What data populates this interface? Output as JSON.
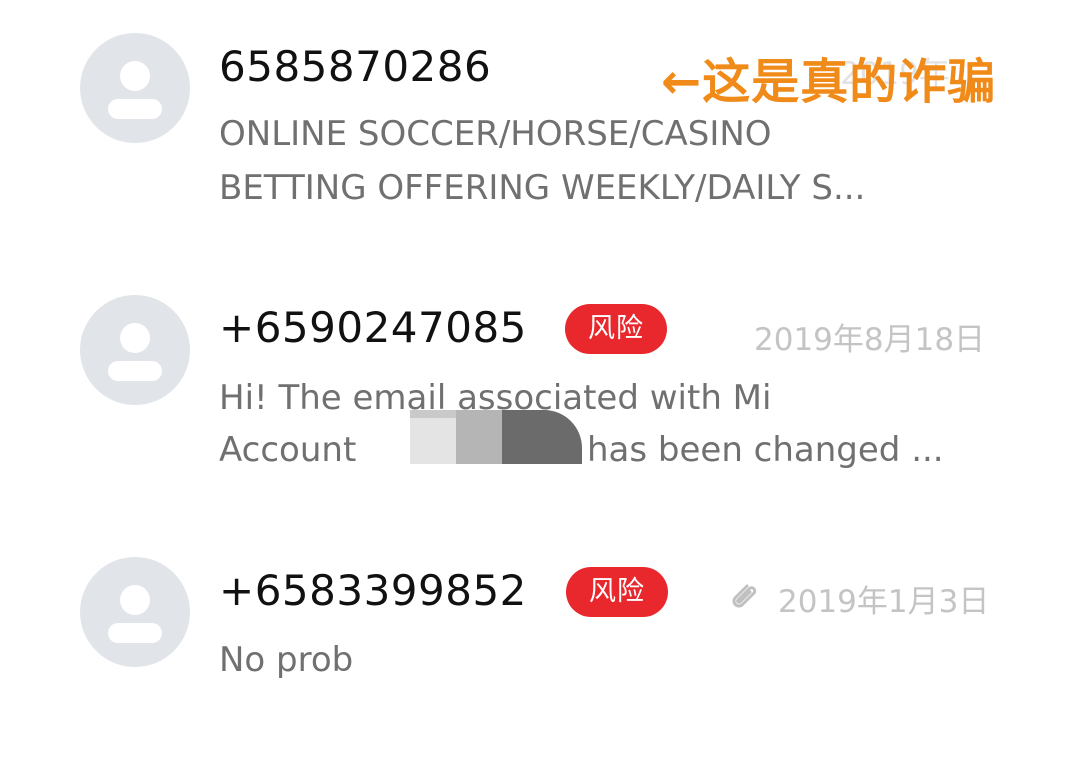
{
  "threads": [
    {
      "sender": "6585870286",
      "badge": "",
      "date": "2019年...",
      "preview_lines": [
        "ONLINE SOCCER/HORSE/CASINO",
        "BETTING OFFERING WEEKLY/DAILY S..."
      ],
      "has_attachment": false
    },
    {
      "sender": "+6590247085",
      "badge": "风险",
      "date": "2019年8月18日",
      "preview_lines": [
        "Hi! The email associated with Mi",
        "Account",
        "has been changed ..."
      ],
      "has_attachment": false
    },
    {
      "sender": "+6583399852",
      "badge": "风险",
      "date": "2019年1月3日",
      "preview_lines": [
        "No prob"
      ],
      "has_attachment": true
    }
  ],
  "annotation": "←这是真的诈骗",
  "colors": {
    "badge": "#e8282d",
    "annotation": "#f08a19",
    "avatar_bg": "#e1e4e8",
    "date": "#c4c4c4",
    "preview": "#707070"
  },
  "icons": {
    "avatar": "person-silhouette-icon",
    "attachment": "paperclip-icon"
  }
}
